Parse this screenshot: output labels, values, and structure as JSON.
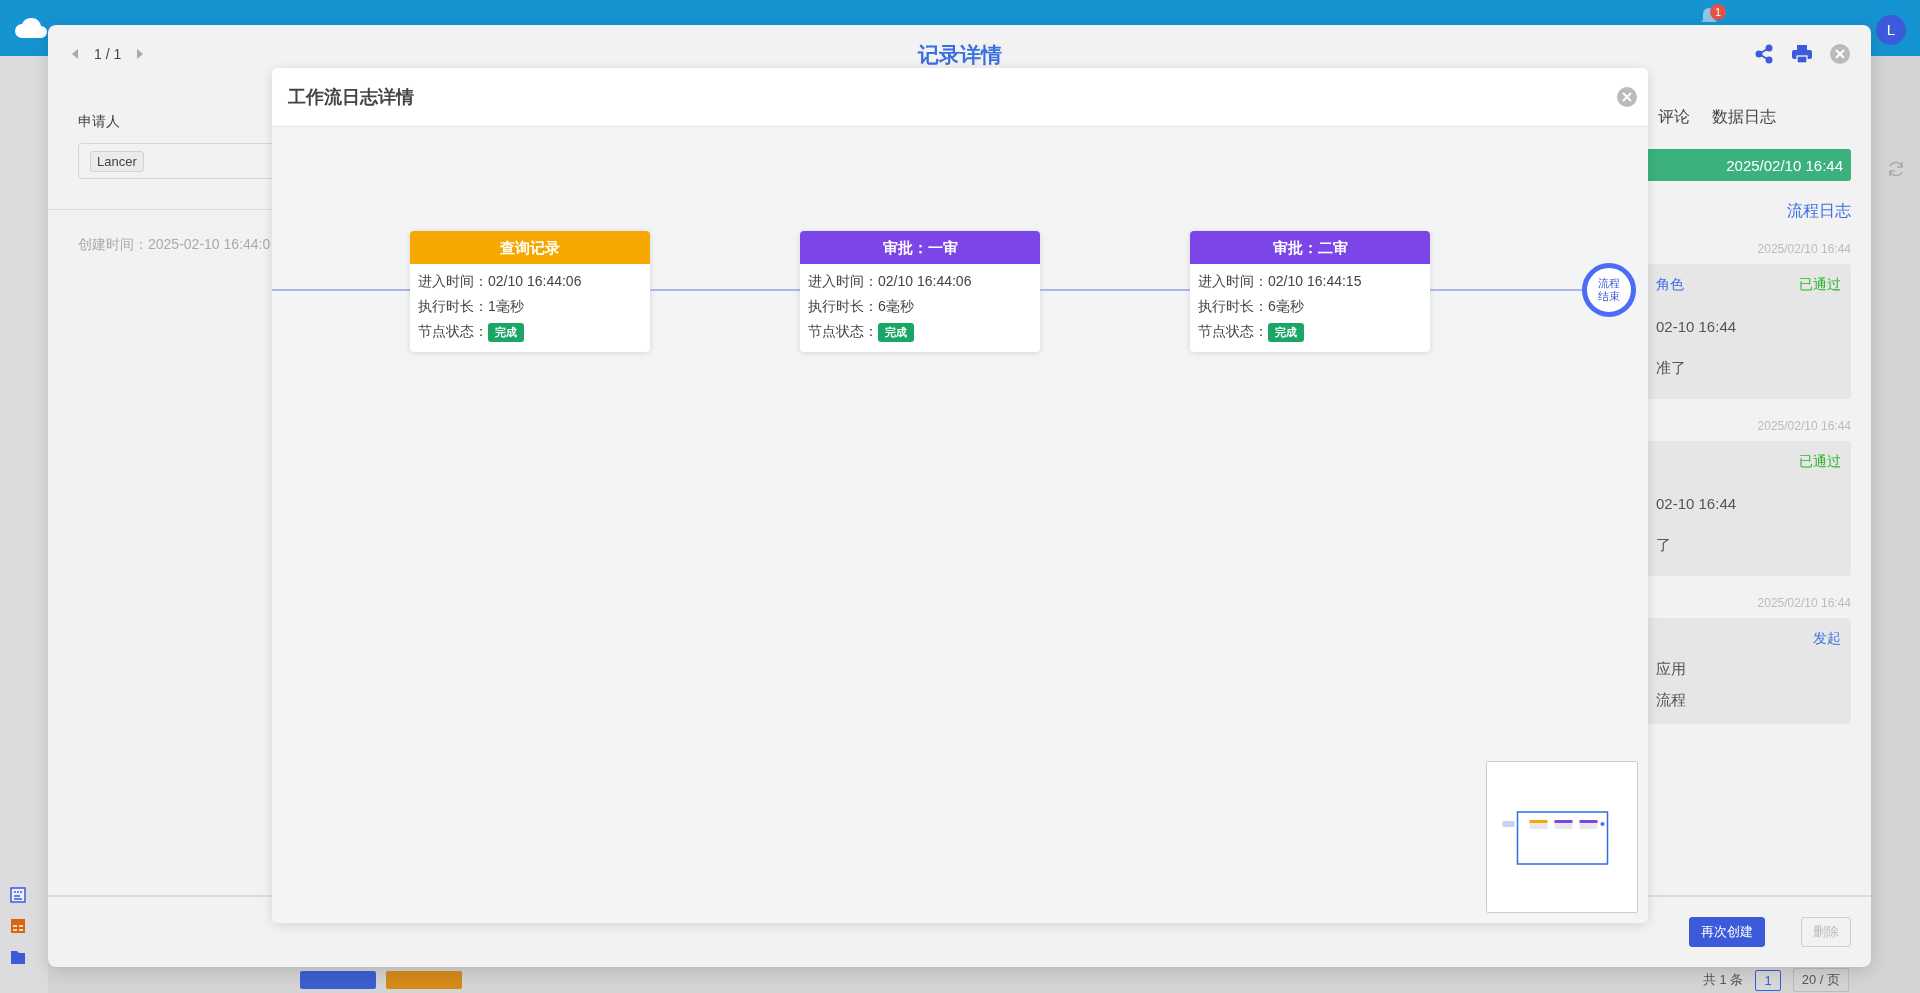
{
  "top_bar": {
    "notification_count": "1",
    "avatar": "L"
  },
  "background_page": {
    "pagination": {
      "total": "共 1 条",
      "current_page": "1",
      "page_size": "20 / 页"
    }
  },
  "record_dialog": {
    "title": "记录详情",
    "pager": "1 / 1",
    "form": {
      "applicant_label": "申请人",
      "applicant_tags": [
        "Lancer"
      ],
      "created_time": "创建时间：2025-02-10 16:44:0"
    },
    "side_panel": {
      "tabs": [
        {
          "label": "评论",
          "selected": false
        },
        {
          "label": "数据日志",
          "selected": false
        }
      ],
      "status_time": "2025/02/10 16:44",
      "flow_log_link": "流程日志",
      "entries": [
        {
          "time": "2025/02/10 16:44",
          "heading": "角色",
          "result": "已通过",
          "kind": "approved",
          "lines": [
            "02-10 16:44",
            "准了"
          ]
        },
        {
          "time": "2025/02/10 16:44",
          "result": "已通过",
          "kind": "approved",
          "lines": [
            "02-10 16:44",
            "了"
          ]
        },
        {
          "time": "2025/02/10 16:44",
          "result": "发起",
          "kind": "started",
          "lines": [
            "应用",
            "流程"
          ]
        }
      ]
    },
    "footer_buttons": [
      {
        "label": "再次创建",
        "disabled": false
      },
      {
        "label": "删除",
        "disabled": true
      }
    ]
  },
  "workflow_dialog": {
    "title": "工作流日志详情",
    "nodes": [
      {
        "title": "查询记录",
        "color": "#f7a800",
        "fields": [
          {
            "label": "进入时间：",
            "value": "02/10 16:44:06"
          },
          {
            "label": "执行时长：",
            "value": "1毫秒"
          }
        ],
        "status_label": "节点状态：",
        "status": "完成"
      },
      {
        "title": "审批：一审",
        "color": "#7b45e8",
        "fields": [
          {
            "label": "进入时间：",
            "value": "02/10 16:44:06"
          },
          {
            "label": "执行时长：",
            "value": "6毫秒"
          }
        ],
        "status_label": "节点状态：",
        "status": "完成"
      },
      {
        "title": "审批：二审",
        "color": "#7b45e8",
        "fields": [
          {
            "label": "进入时间：",
            "value": "02/10 16:44:15"
          },
          {
            "label": "执行时长：",
            "value": "6毫秒"
          }
        ],
        "status_label": "节点状态：",
        "status": "完成"
      }
    ],
    "end_node": "流程结束"
  }
}
